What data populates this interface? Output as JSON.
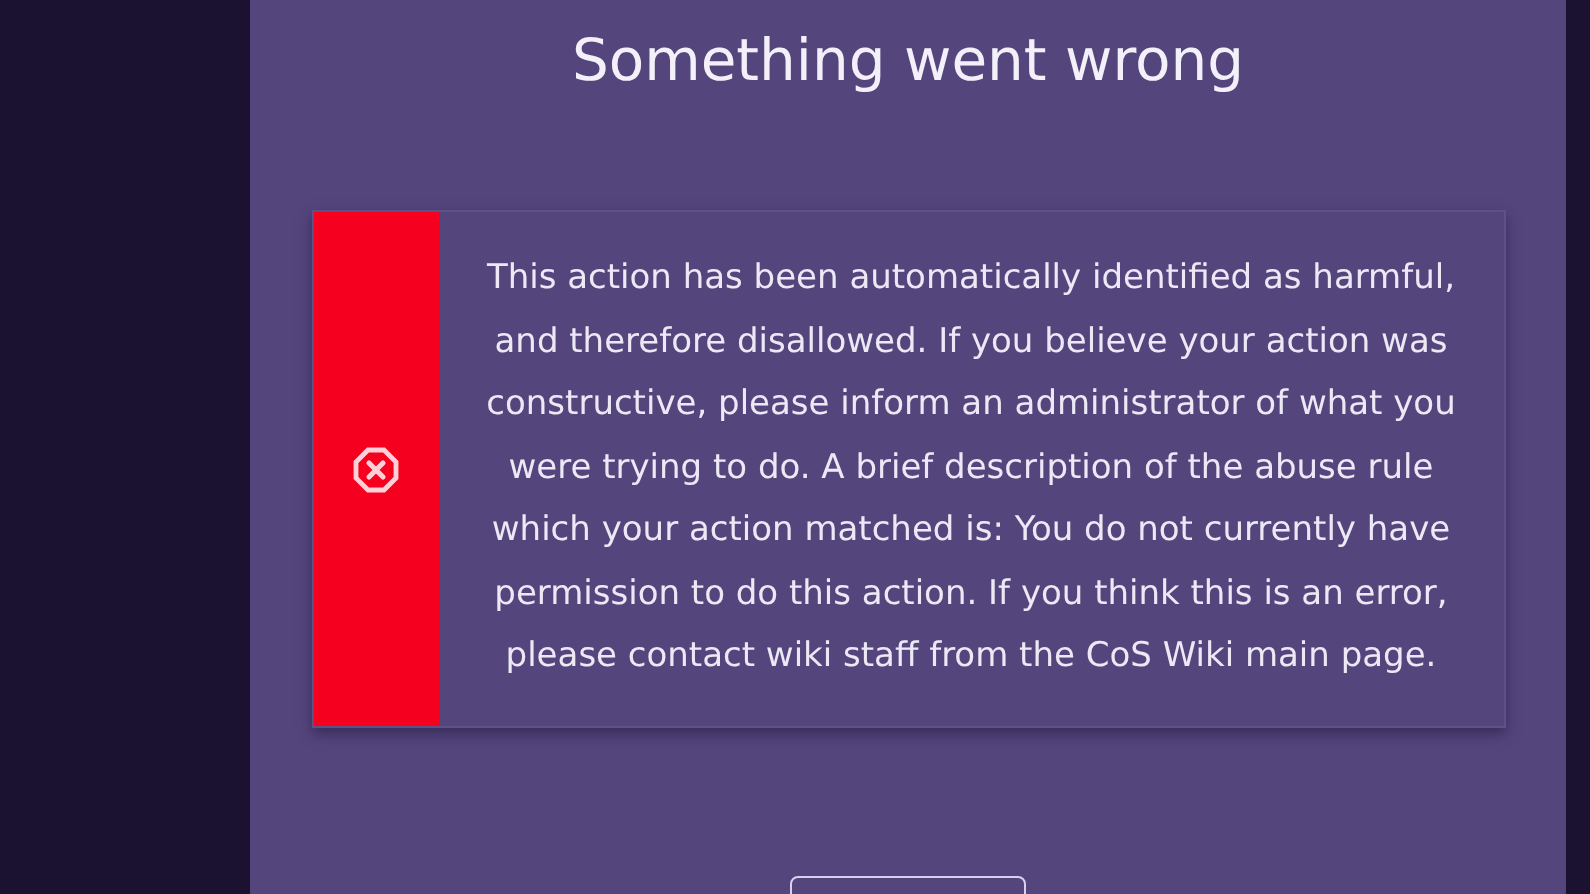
{
  "title": "Something went wrong",
  "error": {
    "kind": "error",
    "message": "This action has been automatically identified as harmful, and therefore disallowed. If you believe your action was constructive, please inform an administrator of what you were trying to do. A brief description of the abuse rule which your action matched is: You do not currently have permission to do this action. If you think this is an error, please contact wiki staff from the CoS Wiki main page."
  }
}
